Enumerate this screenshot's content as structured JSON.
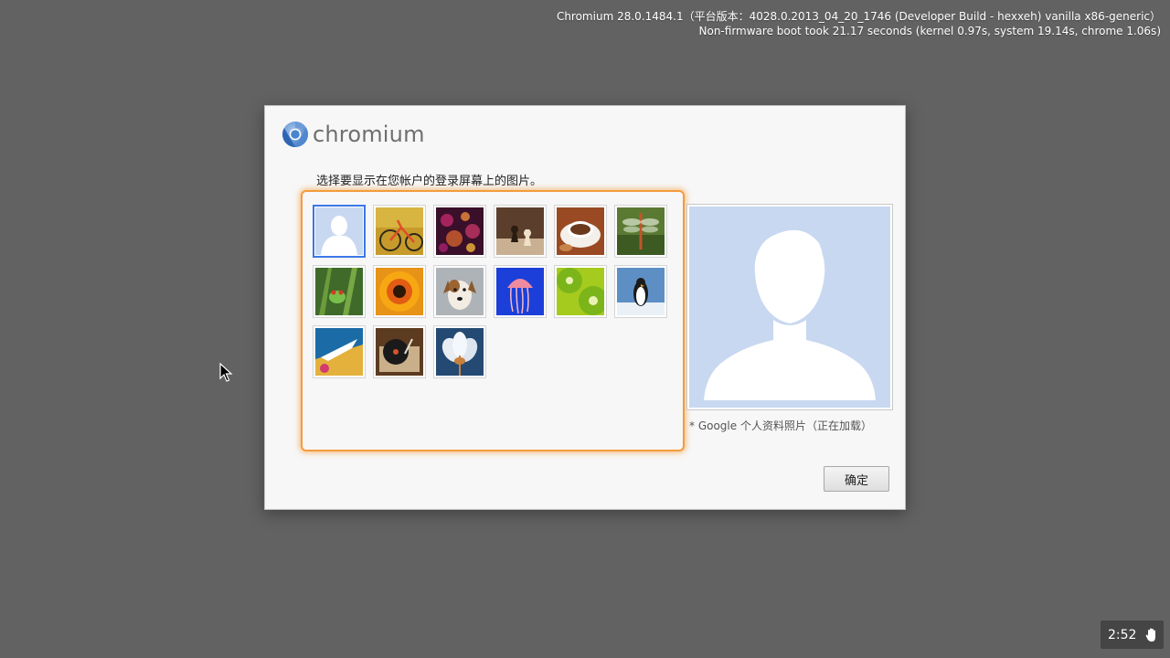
{
  "version_info": {
    "line1": "Chromium 28.0.1484.1（平台版本：4028.0.2013_04_20_1746 (Developer Build - hexxeh) vanilla x86-generic）",
    "line2": "Non-firmware boot took 21.17 seconds (kernel 0.97s, system 19.14s, chrome 1.06s)"
  },
  "dialog": {
    "logo_text": "chromium",
    "instruction": "选择要显示在您帐户的登录屏幕上的图片。",
    "images": [
      {
        "name": "default-silhouette",
        "selected": true
      },
      {
        "name": "bicycle"
      },
      {
        "name": "bokeh"
      },
      {
        "name": "chess"
      },
      {
        "name": "coffee"
      },
      {
        "name": "dragonfly"
      },
      {
        "name": "frog"
      },
      {
        "name": "flower"
      },
      {
        "name": "dog"
      },
      {
        "name": "jellyfish"
      },
      {
        "name": "kiwi"
      },
      {
        "name": "penguin"
      },
      {
        "name": "airplane"
      },
      {
        "name": "turntable"
      },
      {
        "name": "white-flower"
      }
    ],
    "caption": "* Google 个人资料照片（正在加载）",
    "ok_label": "确定"
  },
  "tray": {
    "clock": "2:52",
    "icon": "hand-icon"
  },
  "colors": {
    "background": "#616261",
    "highlight_border": "#f39c3d",
    "selected_border": "#3b78e7",
    "silhouette_bg": "#c8d8f0"
  }
}
